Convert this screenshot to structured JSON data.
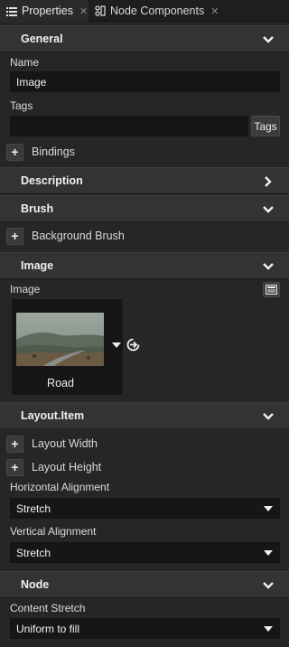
{
  "tabs": [
    {
      "label": "Properties",
      "icon": "list-icon",
      "active": true
    },
    {
      "label": "Node Components",
      "icon": "node-components-icon",
      "active": false
    }
  ],
  "sections": {
    "general": {
      "title": "General",
      "expanded": true
    },
    "description": {
      "title": "Description",
      "expanded": false
    },
    "brush": {
      "title": "Brush",
      "expanded": true
    },
    "image": {
      "title": "Image",
      "expanded": true
    },
    "layout_item": {
      "title": "Layout.Item",
      "expanded": true
    },
    "node": {
      "title": "Node",
      "expanded": true
    }
  },
  "general": {
    "name_label": "Name",
    "name_value": "Image",
    "tags_label": "Tags",
    "tags_value": "",
    "tags_button": "Tags",
    "bindings_label": "Bindings"
  },
  "brush": {
    "background_brush_label": "Background Brush"
  },
  "image": {
    "image_label": "Image",
    "thumbnail_name": "Road"
  },
  "layout_item": {
    "layout_width_label": "Layout Width",
    "layout_height_label": "Layout Height",
    "horizontal_alignment_label": "Horizontal Alignment",
    "horizontal_alignment_value": "Stretch",
    "vertical_alignment_label": "Vertical Alignment",
    "vertical_alignment_value": "Stretch"
  },
  "node": {
    "content_stretch_label": "Content Stretch",
    "content_stretch_value": "Uniform to fill"
  },
  "colors": {
    "panel_background": "#262626",
    "section_header": "#333333",
    "field_background": "#161616",
    "text": "#e0e0e0"
  }
}
